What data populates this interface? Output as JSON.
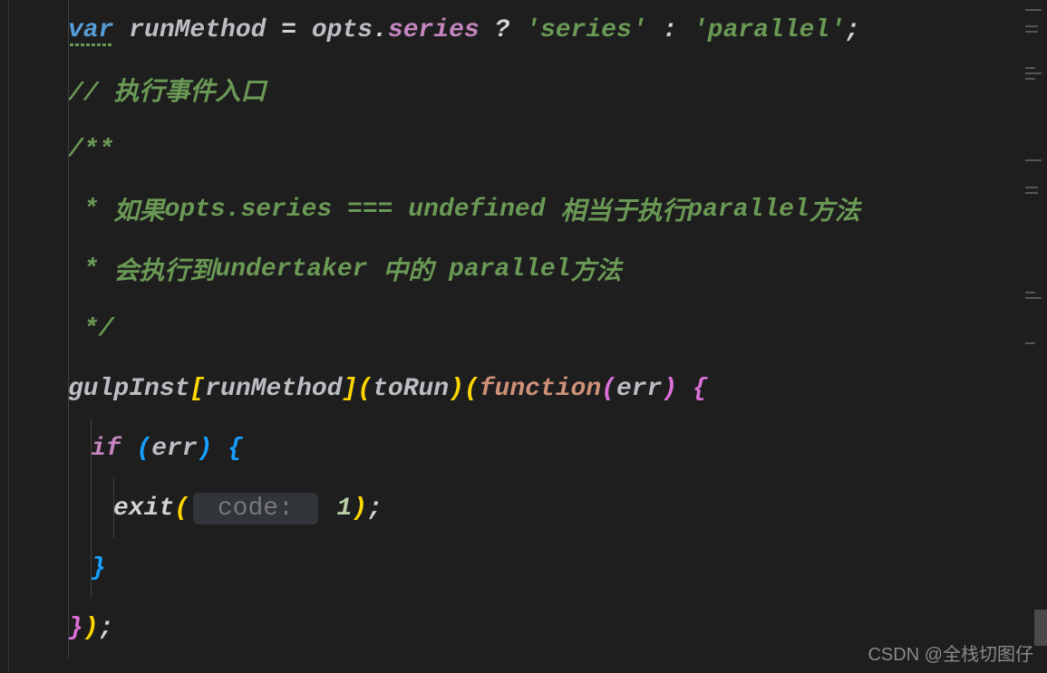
{
  "code": {
    "l1": {
      "var": "var",
      "name": " runMethod ",
      "eq": "= ",
      "obj": "opts",
      "dot": ".",
      "prop": "series",
      "tern": " ? ",
      "str1": "'series'",
      "colon": " : ",
      "str2": "'parallel'",
      "semi": ";"
    },
    "l2": {
      "comment": "// 执行事件入口"
    },
    "l3": {
      "open": "/**"
    },
    "l4": {
      "star": " * ",
      "t1": "如果",
      "b1": "opts.series === undefined",
      "t2": " 相当于执行",
      "b2": "parallel",
      "t3": "方法"
    },
    "l5": {
      "star": " * ",
      "t1": "会执行到",
      "b1": "undertaker",
      "t2": " 中的 ",
      "b2": "parallel",
      "t3": "方法"
    },
    "l6": {
      "close": " */"
    },
    "l7": {
      "obj": "gulpInst",
      "br1": "[",
      "m": "runMethod",
      "br2": "]",
      "p1": "(",
      "arg": "toRun",
      "p2": ")",
      "p3": "(",
      "fn": "function",
      "p4": "(",
      "err": "err",
      "p5": ")",
      "brace": " {"
    },
    "l8": {
      "if": "if ",
      "p1": "(",
      "err": "err",
      "p2": ")",
      "brace": " {"
    },
    "l9": {
      "fn": "exit",
      "p1": "(",
      "hint": " code: ",
      "num": " 1",
      "p2": ")",
      "semi": ";"
    },
    "l10": {
      "brace": "}"
    },
    "l11": {
      "brace": "}",
      "p": ")",
      "semi": ";"
    }
  },
  "watermark": "CSDN @全栈切图仔"
}
